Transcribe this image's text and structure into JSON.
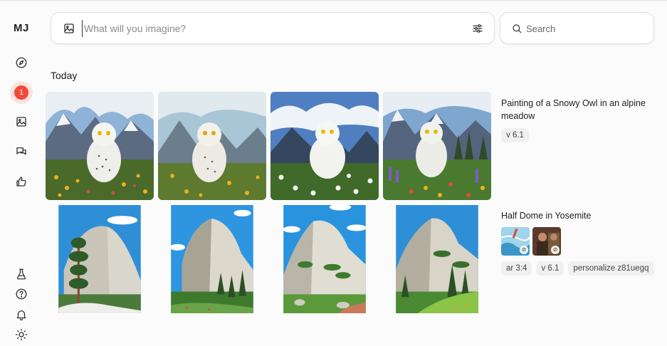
{
  "app": {
    "logo": "MJ"
  },
  "sidebar": {
    "notification_count": "1",
    "items": [
      {
        "icon": "compass-icon"
      },
      {
        "icon": "notification-icon"
      },
      {
        "icon": "image-icon"
      },
      {
        "icon": "chat-icon"
      },
      {
        "icon": "thumbs-up-icon"
      },
      {
        "icon": "flask-icon"
      },
      {
        "icon": "help-icon"
      },
      {
        "icon": "bell-icon"
      },
      {
        "icon": "sun-icon"
      }
    ]
  },
  "prompt": {
    "placeholder": "What will you imagine?",
    "value": ""
  },
  "search": {
    "placeholder": "Search",
    "value": ""
  },
  "feed": {
    "section_title": "Today",
    "jobs": [
      {
        "prompt": "Painting of a Snowy Owl in an alpine meadow",
        "params": [
          "v 6.1"
        ]
      },
      {
        "prompt": "Half Dome in Yosemite",
        "params": [
          "ar 3:4",
          "v 6.1",
          "personalize z81uegq"
        ],
        "reference_images": 2
      }
    ]
  },
  "colors": {
    "accent": "#ef4a3a",
    "badge_bg": "#fde3df"
  }
}
